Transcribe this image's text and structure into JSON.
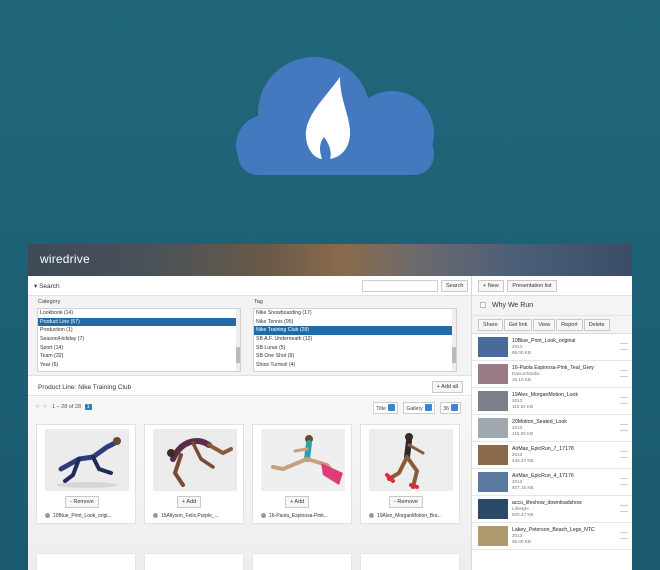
{
  "app": {
    "brand": "wiredrive"
  },
  "search": {
    "toggle_label": "▾ Search",
    "button_label": "Search",
    "placeholder": ""
  },
  "toolbar": {
    "new_label": "+ New",
    "presentation_label": "Presentation list"
  },
  "filters": {
    "category_label": "Category",
    "category_items": [
      "Lookbook (14)",
      "Product Line (57)",
      "Production (1)",
      "Season/Holiday (7)",
      "Sport (14)",
      "Team (32)",
      "Year (6)"
    ],
    "category_selected": 1,
    "tag_label": "Tag",
    "tag_items": [
      "Nike Snowboarding (17)",
      "Nike Tennis (95)",
      "Nike Training Club (28)",
      "SB A.F. Underneath (12)",
      "SB Lunar (5)",
      "SB One Shot (9)",
      "Show Turmoil (4)"
    ],
    "tag_selected": 2
  },
  "results": {
    "title": "Product Line: Nike Training Club",
    "add_all_label": "+ Add all",
    "pager_text": "1 – 28 of 28",
    "page_number": "1",
    "sort_title": "Title",
    "view_gallery": "Gallery",
    "per_page": "36",
    "cards": [
      {
        "button": "- Remove",
        "name": "10Blue_Print_Look_origi..."
      },
      {
        "button": "+ Add",
        "name": "15Allyson_Felix,Purple_..."
      },
      {
        "button": "+ Add",
        "name": "16-Paola_Espinosa-Pink..."
      },
      {
        "button": "- Remove",
        "name": "19Alex_MorganMotion_Bra..."
      }
    ]
  },
  "panel": {
    "title": "Why We Run",
    "actions": [
      "Share",
      "Get link",
      "View",
      "Report",
      "Delete"
    ],
    "items": [
      {
        "name": "10Blue_Print_Look_original",
        "line1": "2013",
        "line2": "88.00 KB"
      },
      {
        "name": "16-Paola Espinosa-Pink_Teal_Grey",
        "line1": "Dance/Studio",
        "line2": "16.10 KB"
      },
      {
        "name": "19Alex_MorganMotion_Look",
        "line1": "2013",
        "line2": "110.92 KB"
      },
      {
        "name": "20Motion_Seated_Look",
        "line1": "2013",
        "line2": "115.00 KB"
      },
      {
        "name": "AirMax_EpicRun_7_17178",
        "line1": "2013",
        "line2": "445.47 KB"
      },
      {
        "name": "AirMax_EpicRun_4_17176",
        "line1": "2013",
        "line2": "407.15 KB"
      },
      {
        "name": "accu_lifeshow_downloadshow",
        "line1": "Lifestyle",
        "line2": "500.47 KB"
      },
      {
        "name": "Lakey_Peterson_Beach_Legs_NTC",
        "line1": "2013",
        "line2": "95.00 KB"
      }
    ]
  },
  "colors": {
    "background": "#1d6176",
    "cloud": "#4479c0",
    "selection": "#1f6aa8"
  },
  "icons": {
    "logo": "cloud-flame-icon"
  }
}
